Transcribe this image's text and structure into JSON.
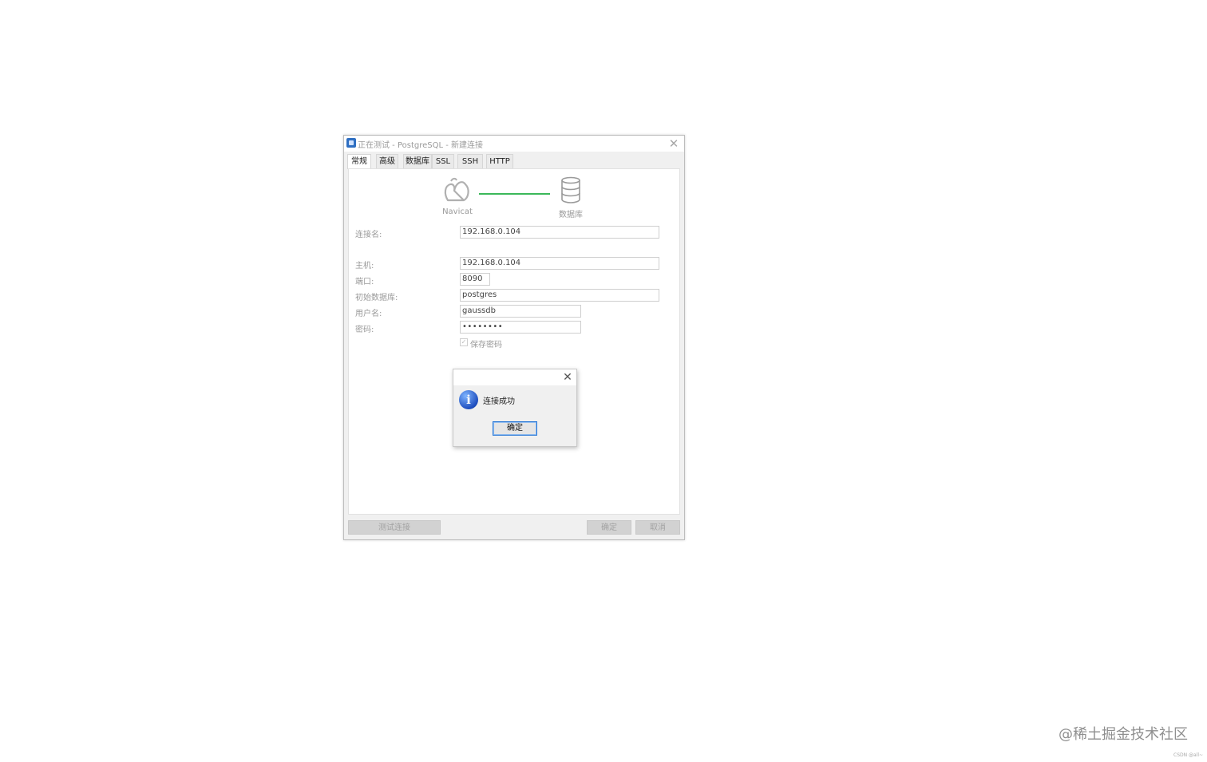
{
  "window": {
    "title": "正在测试 - PostgreSQL - 新建连接",
    "tabs": [
      {
        "label": "常规",
        "active": true
      },
      {
        "label": "高级",
        "active": false
      },
      {
        "label": "数据库",
        "active": false
      },
      {
        "label": "SSL",
        "active": false
      },
      {
        "label": "SSH",
        "active": false
      },
      {
        "label": "HTTP",
        "active": false
      }
    ],
    "diagram": {
      "left_label": "Navicat",
      "right_label": "数据库",
      "link_color": "#3bb85a"
    },
    "form": {
      "connection_name_label": "连接名:",
      "connection_name_value": "192.168.0.104",
      "host_label": "主机:",
      "host_value": "192.168.0.104",
      "port_label": "端口:",
      "port_value": "8090",
      "initial_db_label": "初始数据库:",
      "initial_db_value": "postgres",
      "username_label": "用户名:",
      "username_value": "gaussdb",
      "password_label": "密码:",
      "password_value": "••••••••",
      "save_password_label": "保存密码",
      "save_password_checked": true
    },
    "buttons": {
      "test": "测试连接",
      "ok": "确定",
      "cancel": "取消"
    }
  },
  "message_box": {
    "icon": "info-icon",
    "text": "连接成功",
    "ok_label": "确定",
    "accent": "#2a78d6"
  },
  "watermark": {
    "text": "@稀土掘金技术社区",
    "small": "CSDN @all~"
  }
}
